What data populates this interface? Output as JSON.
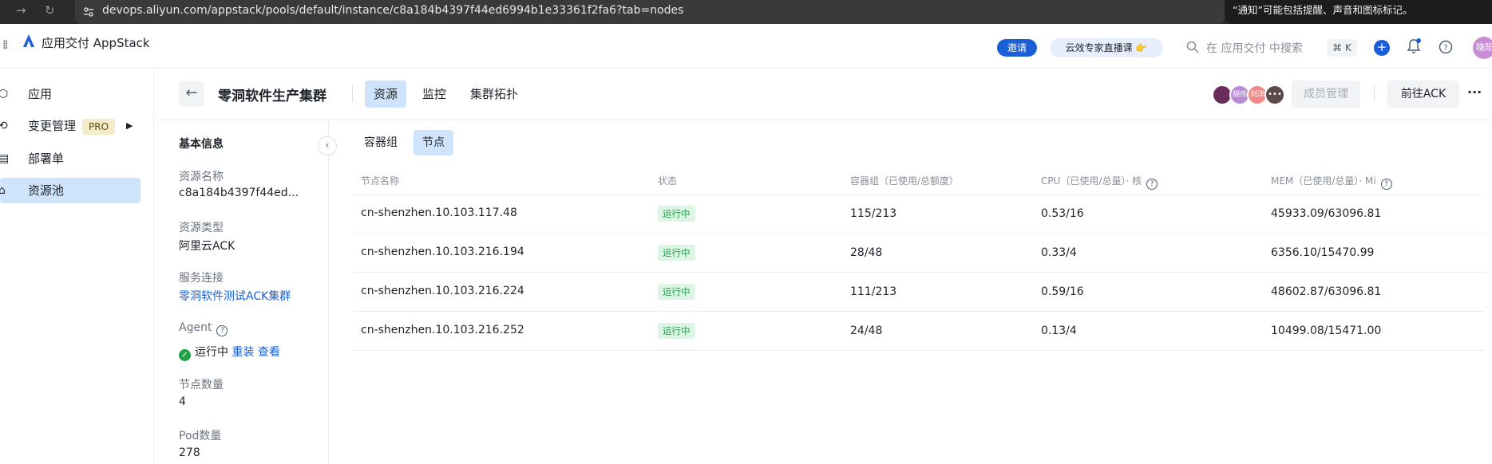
{
  "browser": {
    "url": "devops.aliyun.com/appstack/pools/default/instance/c8a184b4397f44ed6994b1e33361f2fa6?tab=nodes",
    "notification": "“通知”可能包括提醒、声音和图标标记。"
  },
  "header": {
    "app_title": "应用交付 AppStack",
    "invite_label": "邀请",
    "live_label": "云效专家直播课 👉",
    "search_placeholder": "在 应用交付 中搜索",
    "shortcut": "⌘ K",
    "plus": "+",
    "user_avatar": "晓阳"
  },
  "sidebar": {
    "items": [
      {
        "label": "应用"
      },
      {
        "label": "变更管理",
        "badge": "PRO"
      },
      {
        "label": "部署单"
      },
      {
        "label": "资源池"
      }
    ]
  },
  "page": {
    "title": "零洞软件生产集群",
    "tabs": [
      {
        "label": "资源"
      },
      {
        "label": "监控"
      },
      {
        "label": "集群拓扑"
      }
    ],
    "members": [
      "",
      "胡伟",
      "刘洋",
      "•••"
    ],
    "member_manage_label": "成员管理",
    "goto_ack_label": "前往ACK",
    "more": "···"
  },
  "info": {
    "heading": "基本信息",
    "resource_name_label": "资源名称",
    "resource_name": "c8a184b4397f44ed...",
    "resource_type_label": "资源类型",
    "resource_type": "阿里云ACK",
    "service_conn_label": "服务连接",
    "service_conn": "零洞软件测试ACK集群",
    "agent_label": "Agent",
    "agent_status": "运行中",
    "agent_reinstall": "重装",
    "agent_view": "查看",
    "node_count_label": "节点数量",
    "node_count": "4",
    "pod_count_label": "Pod数量",
    "pod_count": "278"
  },
  "subtabs": [
    {
      "label": "容器组"
    },
    {
      "label": "节点"
    }
  ],
  "table": {
    "columns": [
      "节点名称",
      "状态",
      "容器组（已使用/总额度）",
      "CPU（已使用/总量）· 核",
      "MEM（已使用/总量）· Mi"
    ],
    "rows": [
      {
        "name": "cn-shenzhen.10.103.117.48",
        "status": "运行中",
        "pods": "115/213",
        "cpu": "0.53/16",
        "mem": "45933.09/63096.81"
      },
      {
        "name": "cn-shenzhen.10.103.216.194",
        "status": "运行中",
        "pods": "28/48",
        "cpu": "0.33/4",
        "mem": "6356.10/15470.99"
      },
      {
        "name": "cn-shenzhen.10.103.216.224",
        "status": "运行中",
        "pods": "111/213",
        "cpu": "0.59/16",
        "mem": "48602.87/63096.81"
      },
      {
        "name": "cn-shenzhen.10.103.216.252",
        "status": "运行中",
        "pods": "24/48",
        "cpu": "0.13/4",
        "mem": "10499.08/15471.00"
      }
    ]
  }
}
